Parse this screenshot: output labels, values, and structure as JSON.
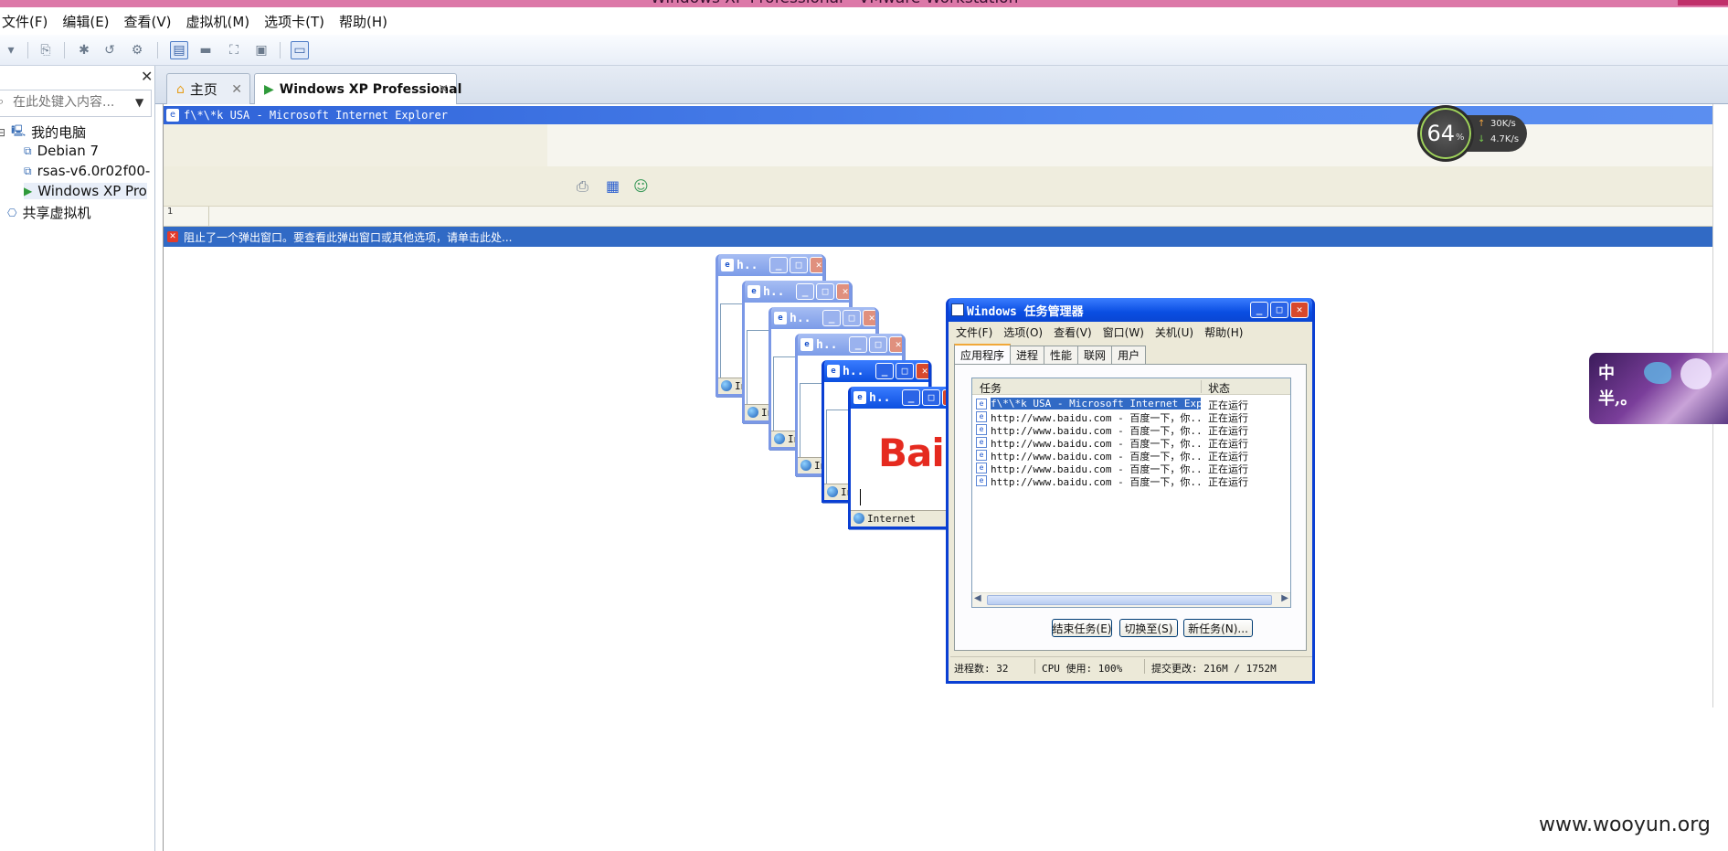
{
  "window": {
    "title": "Windows XP Professional - VMware Workstation"
  },
  "menubar": [
    "文件(F)",
    "编辑(E)",
    "查看(V)",
    "虚拟机(M)",
    "选项卡(T)",
    "帮助(H)"
  ],
  "sidebar": {
    "search_placeholder": "在此处键入内容...",
    "tree": [
      {
        "label": "我的电脑"
      },
      {
        "label": "Debian 7"
      },
      {
        "label": "rsas-v6.0r02f00-"
      },
      {
        "label": "Windows XP Pro"
      },
      {
        "label": "共享虚拟机"
      }
    ]
  },
  "tabs": [
    {
      "label": "主页"
    },
    {
      "label": "Windows XP Professional"
    }
  ],
  "ie": {
    "title": "f\\*\\*k USA - Microsoft Internet Explorer",
    "popup_bar": "阻止了一个弹出窗口。要查看此弹出窗口或其他选项，请单击此处...",
    "address_hint": "1"
  },
  "popups": {
    "title": "h..",
    "status": "Internet",
    "logo": "Bai"
  },
  "task_manager": {
    "title": "Windows 任务管理器",
    "menu": [
      "文件(F)",
      "选项(O)",
      "查看(V)",
      "窗口(W)",
      "关机(U)",
      "帮助(H)"
    ],
    "tabs": [
      "应用程序",
      "进程",
      "性能",
      "联网",
      "用户"
    ],
    "columns": {
      "task": "任务",
      "status": "状态"
    },
    "rows": [
      {
        "task": "f\\*\\*k USA - Microsoft Internet Exp...",
        "status": "正在运行"
      },
      {
        "task": "http://www.baidu.com - 百度一下，你...",
        "status": "正在运行"
      },
      {
        "task": "http://www.baidu.com - 百度一下，你...",
        "status": "正在运行"
      },
      {
        "task": "http://www.baidu.com - 百度一下，你...",
        "status": "正在运行"
      },
      {
        "task": "http://www.baidu.com - 百度一下，你...",
        "status": "正在运行"
      },
      {
        "task": "http://www.baidu.com - 百度一下，你...",
        "status": "正在运行"
      },
      {
        "task": "http://www.baidu.com - 百度一下，你...",
        "status": "正在运行"
      }
    ],
    "buttons": {
      "end_task": "结束任务(E)",
      "switch_to": "切换至(S)",
      "new_task": "新任务(N)..."
    },
    "statusbar": {
      "processes": "进程数: 32",
      "cpu": "CPU 使用: 100%",
      "commit": "提交更改: 216M / 1752M"
    }
  },
  "speed_widget": {
    "percent": "64",
    "percent_unit": "%",
    "up": "30K/s",
    "down": "4.7K/s"
  },
  "decoration": {
    "line1": "中",
    "line2": "半,。"
  },
  "watermark": "www.wooyun.org"
}
